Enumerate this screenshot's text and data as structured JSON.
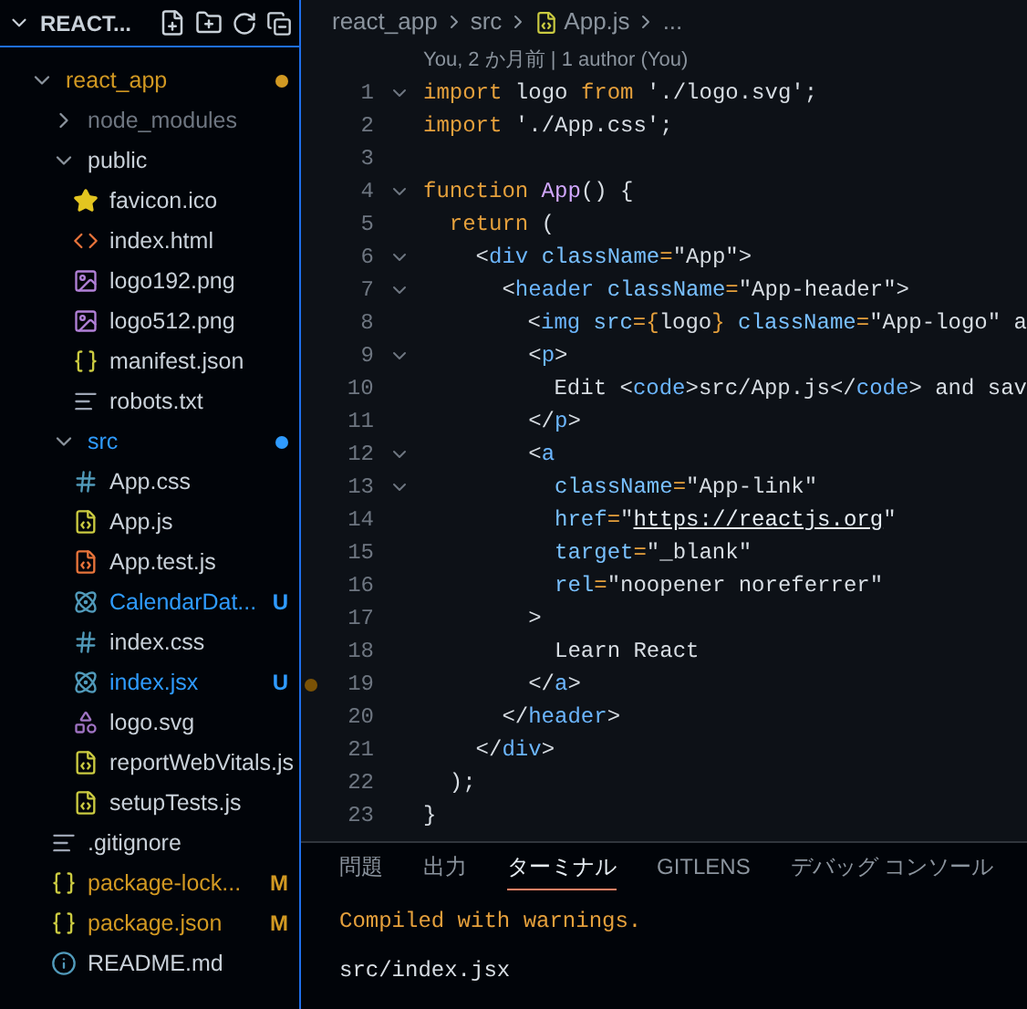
{
  "explorer": {
    "title": "REACT...",
    "tree": [
      {
        "label": "react_app",
        "kind": "folder",
        "expanded": true,
        "color": "#d29922",
        "children": [
          {
            "label": "node_modules",
            "kind": "folder",
            "expanded": false,
            "color": "#6e7681"
          },
          {
            "label": "public",
            "kind": "folder",
            "expanded": true,
            "children": [
              {
                "label": "favicon.ico",
                "kind": "favicon"
              },
              {
                "label": "index.html",
                "kind": "html"
              },
              {
                "label": "logo192.png",
                "kind": "image"
              },
              {
                "label": "logo512.png",
                "kind": "image"
              },
              {
                "label": "manifest.json",
                "kind": "json"
              },
              {
                "label": "robots.txt",
                "kind": "text"
              }
            ]
          },
          {
            "label": "src",
            "kind": "folder",
            "expanded": true,
            "color": "#2f9bff",
            "children": [
              {
                "label": "App.css",
                "kind": "css"
              },
              {
                "label": "App.js",
                "kind": "js"
              },
              {
                "label": "App.test.js",
                "kind": "test"
              },
              {
                "label": "CalendarDat...",
                "kind": "react",
                "color": "#2f9bff",
                "badge": "U"
              },
              {
                "label": "index.css",
                "kind": "css"
              },
              {
                "label": "index.jsx",
                "kind": "react",
                "color": "#2f9bff",
                "badge": "U"
              },
              {
                "label": "logo.svg",
                "kind": "svg"
              },
              {
                "label": "reportWebVitals.js",
                "kind": "js"
              },
              {
                "label": "setupTests.js",
                "kind": "js"
              }
            ]
          },
          {
            "label": ".gitignore",
            "kind": "text"
          },
          {
            "label": "package-lock...",
            "kind": "json",
            "color": "#d29922",
            "badge": "M"
          },
          {
            "label": "package.json",
            "kind": "json",
            "color": "#d29922",
            "badge": "M"
          },
          {
            "label": "README.md",
            "kind": "info"
          }
        ]
      }
    ]
  },
  "breadcrumb": [
    "react_app",
    "src",
    "App.js",
    "..."
  ],
  "blame": "You, 2 か月前 | 1 author (You)",
  "code": [
    {
      "n": "1",
      "fold": true,
      "tokens": [
        {
          "t": "import",
          "kind": "kw"
        },
        {
          "t": " logo ",
          "kind": "plain"
        },
        {
          "t": "from",
          "kind": "kw"
        },
        {
          "t": " './logo.svg';",
          "kind": "plain"
        }
      ]
    },
    {
      "n": "2",
      "fold": false,
      "tokens": [
        {
          "t": "import",
          "kind": "kw"
        },
        {
          "t": " './App.css';",
          "kind": "plain"
        }
      ]
    },
    {
      "n": "3",
      "fold": false
    },
    {
      "n": "4",
      "fold": true,
      "tokens": [
        {
          "t": "function",
          "kind": "kw"
        },
        {
          "t": " App",
          "kind": "fn"
        },
        {
          "t": "() {",
          "kind": "plain"
        }
      ]
    },
    {
      "n": "5",
      "fold": false,
      "tokens": [
        {
          "t": "  return",
          "kind": "kw"
        },
        {
          "t": " (",
          "kind": "plain"
        }
      ]
    },
    {
      "n": "6",
      "fold": true,
      "tokens": [
        {
          "t": "    <",
          "kind": "plain"
        },
        {
          "t": "div",
          "kind": "tag"
        },
        {
          "t": " className",
          "kind": "attr"
        },
        {
          "t": "=",
          "kind": "op"
        },
        {
          "t": "\"App\">",
          "kind": "plain"
        }
      ]
    },
    {
      "n": "7",
      "fold": true,
      "tokens": [
        {
          "t": "      <",
          "kind": "plain"
        },
        {
          "t": "header",
          "kind": "tag"
        },
        {
          "t": " className",
          "kind": "attr"
        },
        {
          "t": "=",
          "kind": "op"
        },
        {
          "t": "\"App-header\">",
          "kind": "plain"
        }
      ]
    },
    {
      "n": "8",
      "fold": false,
      "tokens": [
        {
          "t": "        <",
          "kind": "plain"
        },
        {
          "t": "img",
          "kind": "tag"
        },
        {
          "t": " src",
          "kind": "attr"
        },
        {
          "t": "={",
          "kind": "op"
        },
        {
          "t": "logo",
          "kind": "plain"
        },
        {
          "t": "}",
          "kind": "op"
        },
        {
          "t": " className",
          "kind": "attr"
        },
        {
          "t": "=",
          "kind": "op"
        },
        {
          "t": "\"App-logo\" a",
          "kind": "plain"
        }
      ]
    },
    {
      "n": "9",
      "fold": true,
      "tokens": [
        {
          "t": "        <",
          "kind": "plain"
        },
        {
          "t": "p",
          "kind": "tag"
        },
        {
          "t": ">",
          "kind": "plain"
        }
      ]
    },
    {
      "n": "10",
      "fold": false,
      "tokens": [
        {
          "t": "          Edit <",
          "kind": "plain"
        },
        {
          "t": "code",
          "kind": "tag"
        },
        {
          "t": ">src/App.js</",
          "kind": "plain"
        },
        {
          "t": "code",
          "kind": "tag"
        },
        {
          "t": "> and sav",
          "kind": "plain"
        }
      ]
    },
    {
      "n": "11",
      "fold": false,
      "tokens": [
        {
          "t": "        </",
          "kind": "plain"
        },
        {
          "t": "p",
          "kind": "tag"
        },
        {
          "t": ">",
          "kind": "plain"
        }
      ]
    },
    {
      "n": "12",
      "fold": true,
      "tokens": [
        {
          "t": "        <",
          "kind": "plain"
        },
        {
          "t": "a",
          "kind": "tag"
        }
      ]
    },
    {
      "n": "13",
      "fold": true,
      "tokens": [
        {
          "t": "          className",
          "kind": "attr"
        },
        {
          "t": "=",
          "kind": "op"
        },
        {
          "t": "\"App-link\"",
          "kind": "plain"
        }
      ]
    },
    {
      "n": "14",
      "fold": false,
      "tokens": [
        {
          "t": "          href",
          "kind": "attr"
        },
        {
          "t": "=",
          "kind": "op"
        },
        {
          "t": "\"",
          "kind": "plain"
        },
        {
          "t": "https://reactjs.org",
          "kind": "link"
        },
        {
          "t": "\"",
          "kind": "plain"
        }
      ]
    },
    {
      "n": "15",
      "fold": false,
      "tokens": [
        {
          "t": "          target",
          "kind": "attr"
        },
        {
          "t": "=",
          "kind": "op"
        },
        {
          "t": "\"_blank\"",
          "kind": "plain"
        }
      ]
    },
    {
      "n": "16",
      "fold": false,
      "tokens": [
        {
          "t": "          rel",
          "kind": "attr"
        },
        {
          "t": "=",
          "kind": "op"
        },
        {
          "t": "\"noopener noreferrer\"",
          "kind": "plain"
        }
      ]
    },
    {
      "n": "17",
      "fold": false,
      "tokens": [
        {
          "t": "        >",
          "kind": "plain"
        }
      ]
    },
    {
      "n": "18",
      "fold": false,
      "tokens": [
        {
          "t": "          Learn React",
          "kind": "plain"
        }
      ]
    },
    {
      "n": "19",
      "fold": false,
      "modified": true,
      "tokens": [
        {
          "t": "        </",
          "kind": "plain"
        },
        {
          "t": "a",
          "kind": "tag"
        },
        {
          "t": ">",
          "kind": "plain"
        }
      ]
    },
    {
      "n": "20",
      "fold": false,
      "tokens": [
        {
          "t": "      </",
          "kind": "plain"
        },
        {
          "t": "header",
          "kind": "tag"
        },
        {
          "t": ">",
          "kind": "plain"
        }
      ]
    },
    {
      "n": "21",
      "fold": false,
      "tokens": [
        {
          "t": "    </",
          "kind": "plain"
        },
        {
          "t": "div",
          "kind": "tag"
        },
        {
          "t": ">",
          "kind": "plain"
        }
      ]
    },
    {
      "n": "22",
      "fold": false,
      "tokens": [
        {
          "t": "  );",
          "kind": "plain"
        }
      ]
    },
    {
      "n": "23",
      "fold": false,
      "tokens": [
        {
          "t": "}",
          "kind": "plain"
        }
      ]
    }
  ],
  "panel": {
    "tabs": [
      {
        "label": "問題",
        "selected": false
      },
      {
        "label": "出力",
        "selected": false
      },
      {
        "label": "ターミナル",
        "selected": true
      },
      {
        "label": "GITLENS",
        "selected": false
      },
      {
        "label": "デバッグ コンソール",
        "selected": false
      }
    ],
    "terminal": [
      {
        "kind": "warning",
        "text": "Compiled with warnings."
      },
      {
        "kind": "blank"
      },
      {
        "kind": "plain",
        "text": "src/index.jsx"
      }
    ]
  }
}
